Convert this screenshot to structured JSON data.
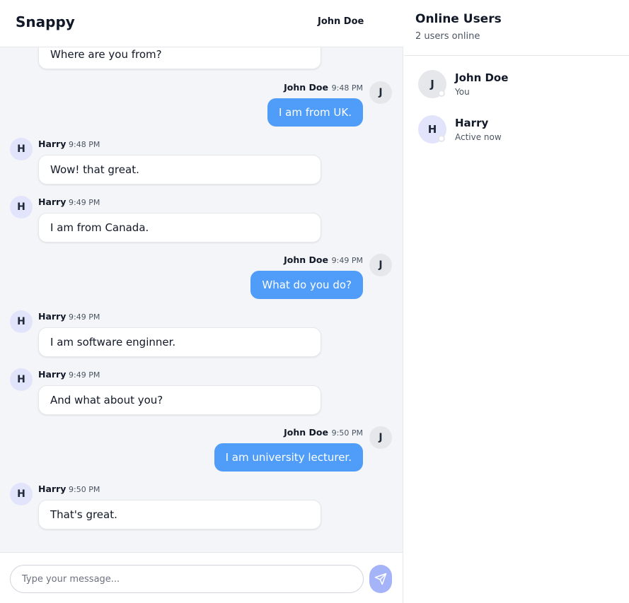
{
  "header": {
    "brand": "Snappy",
    "current_user": "John Doe"
  },
  "messages": [
    {
      "author": "",
      "time": "",
      "text": "Where are you from?",
      "avatar": ""
    },
    {
      "author": "John Doe",
      "time": "9:48 PM",
      "text": "I am from UK.",
      "avatar": "J"
    },
    {
      "author": "Harry",
      "time": "9:48 PM",
      "text": "Wow! that great.",
      "avatar": "H"
    },
    {
      "author": "Harry",
      "time": "9:49 PM",
      "text": "I am from Canada.",
      "avatar": "H"
    },
    {
      "author": "John Doe",
      "time": "9:49 PM",
      "text": "What do you do?",
      "avatar": "J"
    },
    {
      "author": "Harry",
      "time": "9:49 PM",
      "text": "I am software enginner.",
      "avatar": "H"
    },
    {
      "author": "Harry",
      "time": "9:49 PM",
      "text": "And what about you?",
      "avatar": "H"
    },
    {
      "author": "John Doe",
      "time": "9:50 PM",
      "text": "I am university lecturer.",
      "avatar": "J"
    },
    {
      "author": "Harry",
      "time": "9:50 PM",
      "text": "That's great.",
      "avatar": "H"
    }
  ],
  "composer": {
    "placeholder": "Type your message...",
    "value": "",
    "send_icon": "paper-plane-icon"
  },
  "sidebar": {
    "title": "Online Users",
    "subtitle": "2 users online",
    "users": [
      {
        "initial": "J",
        "name": "John Doe",
        "status": "You"
      },
      {
        "initial": "H",
        "name": "Harry",
        "status": "Active now"
      }
    ]
  },
  "colors": {
    "outgoing_bubble": "#4f9df8",
    "send_button": "#a5b4f8",
    "chat_background": "#f4f5f8"
  }
}
